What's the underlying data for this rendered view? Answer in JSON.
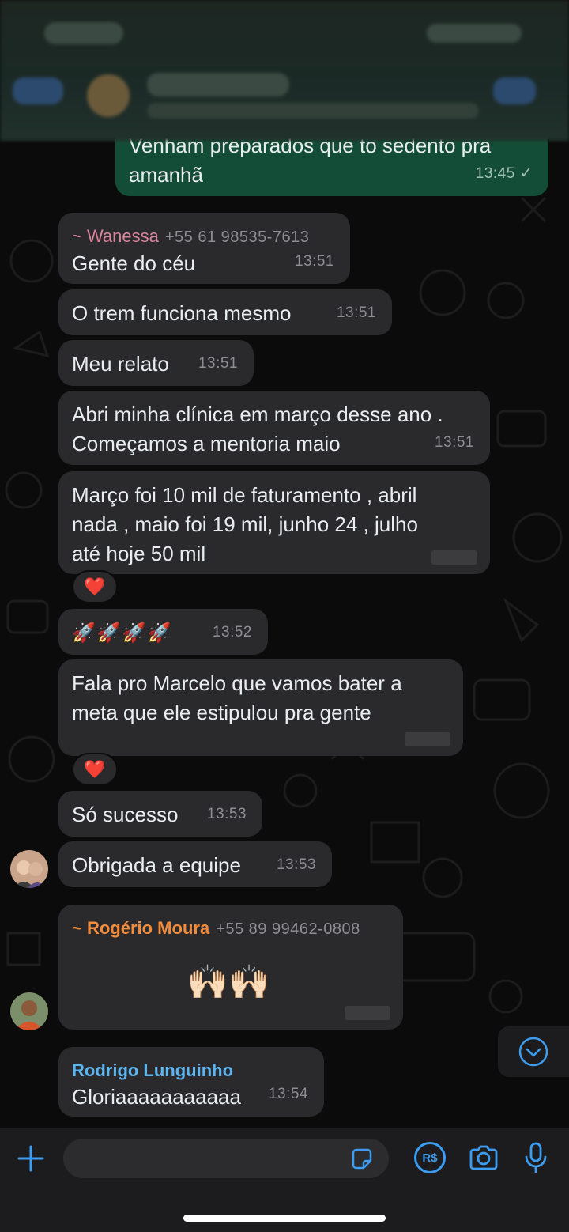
{
  "colors": {
    "incoming_bubble": "#2a2a2c",
    "outgoing_bubble": "#144d37",
    "accent_blue": "#3c9cf0",
    "sender_wanessa": "#d9849c",
    "sender_rogerio": "#f08c3c",
    "sender_rodrigo": "#5cb4f0"
  },
  "messages": [
    {
      "text": "Venham preparados que to sedento pra\namanhã",
      "time": "13:45 ✓"
    },
    {
      "sender": "~ Wanessa",
      "phone": "+55 61 98535-7613",
      "text": "Gente do céu",
      "time": "13:51"
    },
    {
      "text": "O trem funciona mesmo",
      "time": "13:51"
    },
    {
      "text": "Meu relato",
      "time": "13:51"
    },
    {
      "text": "Abri minha clínica em março desse ano .\nComeçamos a mentoria maio",
      "time": "13:51"
    },
    {
      "text": "Março foi 10 mil de faturamento , abril\nnada , maio foi 19 mil, junho 24 , julho\naté hoje 50 mil",
      "reaction": "❤️"
    },
    {
      "text": "🚀🚀🚀🚀",
      "time": "13:52"
    },
    {
      "text": "Fala pro Marcelo que vamos bater a\nmeta que ele estipulou pra gente",
      "reaction": "❤️"
    },
    {
      "text": "Só sucesso",
      "time": "13:53"
    },
    {
      "text": "Obrigada a equipe",
      "time": "13:53"
    },
    {
      "sender": "~ Rogério Moura",
      "phone": "+55 89 99462-0808",
      "text": "🙌🏻🙌🏻"
    },
    {
      "sender": "Rodrigo Lunguinho",
      "text": "Gloriaaaaaaaaaaa",
      "time": "13:54"
    }
  ],
  "input": {
    "icons": [
      "plus-icon",
      "sticker-icon",
      "pix-brl-icon",
      "camera-icon",
      "microphone-icon"
    ],
    "pix_label": "R$"
  }
}
